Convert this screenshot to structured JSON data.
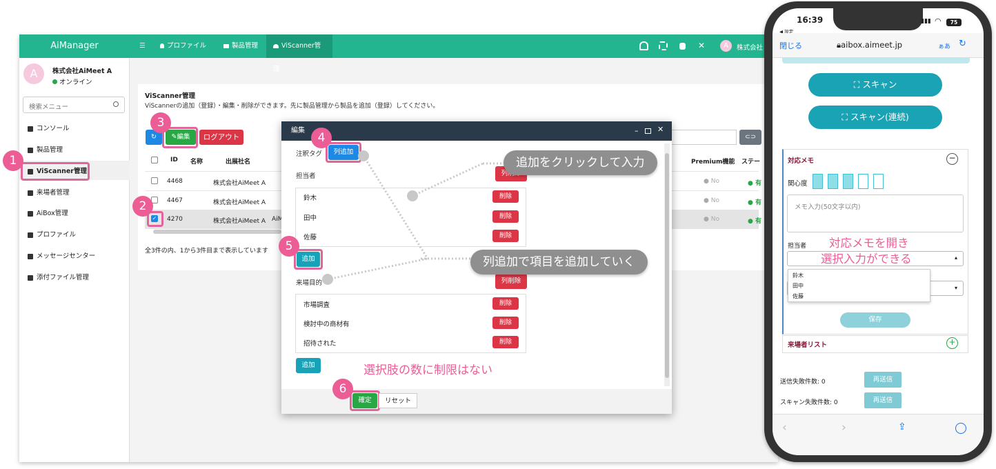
{
  "app": {
    "brand": "AiManager",
    "nav": [
      "プロファイル",
      "製品管理",
      "ViScanner管理"
    ],
    "company_short": "株式会社"
  },
  "sidebar": {
    "avatar_letter": "A",
    "company": "株式会社AiMeet A",
    "status": "オンライン",
    "search_placeholder": "検索メニュー",
    "items": [
      "コンソール",
      "製品管理",
      "ViScanner管理",
      "来場者管理",
      "AiBox管理",
      "プロファイル",
      "メッセージセンター",
      "添付ファイル管理"
    ]
  },
  "page": {
    "title": "ViScanner管理",
    "description": "ViScannerの追加（登録）・編集・削除ができます。先に製品管理から製品を追加（登録）してください。",
    "edit_label": "編集",
    "logout_label": "ログアウト",
    "columns": [
      "ID",
      "名称",
      "出展社名",
      "Premium機能",
      "ステー"
    ],
    "rows": [
      {
        "id": "4468",
        "company": "株式会社AiMeet A",
        "premium": "No",
        "status": "有",
        "checked": false
      },
      {
        "id": "4467",
        "company": "株式会社AiMeet A",
        "premium": "No",
        "status": "有",
        "checked": false
      },
      {
        "id": "4270",
        "company": "株式会社AiMeet A",
        "extra": "AiM",
        "premium": "No",
        "status": "有",
        "checked": true
      }
    ],
    "footer": "全3件の内、1から3件目まで表示しています"
  },
  "modal": {
    "title": "編集",
    "tag_label": "注釈タグ",
    "add_column_label": "列追加",
    "owner_label": "担当者",
    "delete_column_label": "列削除",
    "owners": [
      "鈴木",
      "田中",
      "佐藤"
    ],
    "delete_label": "削除",
    "add_label": "追加",
    "purpose_label": "来場目的",
    "purposes": [
      "市場調査",
      "検討中の商材有",
      "招待された"
    ],
    "confirm_label": "確定",
    "reset_label": "リセット"
  },
  "annotations": {
    "badges": [
      "1",
      "2",
      "3",
      "4",
      "5",
      "6"
    ],
    "callout_click": "追加をクリックして入力",
    "callout_add": "列追加で項目を追加していく",
    "no_limit": "選択肢の数に制限はない",
    "memo_note_1": "対応メモを開き",
    "memo_note_2": "選択入力ができる"
  },
  "phone": {
    "time": "16:39",
    "back_app": "◀ 設定",
    "battery": "75",
    "close": "閉じる",
    "url": "aibox.aimeet.jp",
    "text_size": "ぁあ",
    "scan": "スキャン",
    "scan_continuous": "スキャン(連続)",
    "memo_title": "対応メモ",
    "interest": "関心度",
    "interest_level": 3,
    "memo_placeholder": "メモ入力(50文字以内)",
    "owner_label": "担当者",
    "owner_options": [
      "鈴木",
      "田中",
      "佐藤"
    ],
    "save": "保存",
    "visitor_list": "来場者リスト",
    "send_fail": "送信失敗件数: 0",
    "scan_fail": "スキャン失敗件数: 0",
    "resend": "再送信"
  }
}
